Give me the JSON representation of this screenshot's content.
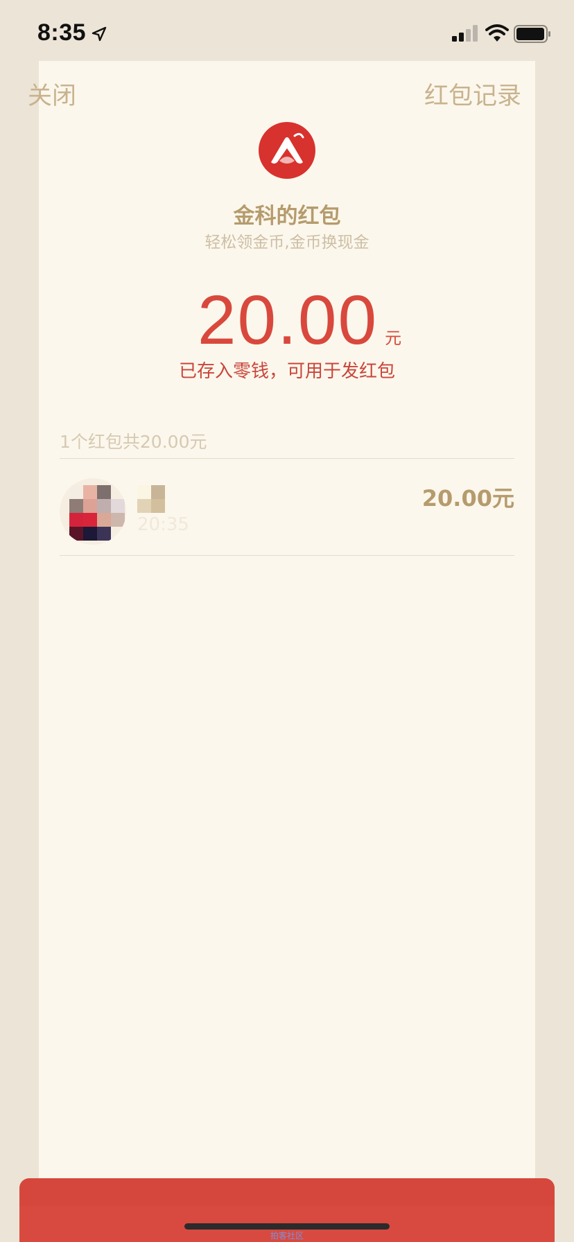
{
  "status_bar": {
    "time": "8:35"
  },
  "nav": {
    "close_label": "关闭",
    "record_label": "红包记录"
  },
  "sender": {
    "logo_icon": "red-envelope-app-logo",
    "name": "金科的红包",
    "slogan": "轻松领金币,金币换现金"
  },
  "amount": {
    "value": "20.00",
    "unit": "元",
    "note": "已存入零钱，可用于发红包"
  },
  "summary": {
    "text": "1个红包共20.00元"
  },
  "receivers": [
    {
      "time": "20:35",
      "amount": "20.00元"
    }
  ],
  "bottom": {
    "caption": "拍客社区"
  },
  "colors": {
    "accent_red": "#d9483d",
    "gold_text": "#b59b6d",
    "card_bg": "#fcf7ec",
    "page_bg": "#ece4d6"
  }
}
